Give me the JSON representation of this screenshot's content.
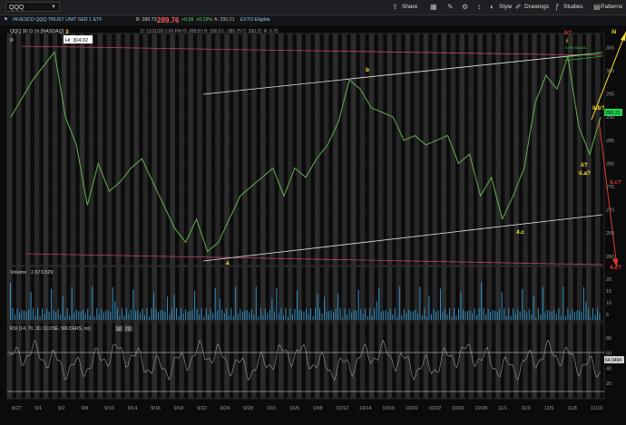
{
  "toolbar": {
    "symbol": "QQQ",
    "share_label": "Share",
    "style_label": "Style",
    "drawings_label": "Drawings",
    "studies_label": "Studies",
    "patterns_label": "Patterns"
  },
  "info": {
    "symbol_desc": "QQQ 90 D 1h [NASDAQ]",
    "fund_name": "INVESCO QQQ TRUST UNIT SER 1 ETF",
    "last_price": "289.76",
    "change_top": "+0.56",
    "change_bottom": "+0.19%",
    "bid_ask_top": "B: 289.73",
    "bid_ask_bottom": "A: 290.21",
    "ext_label": "EXTO Eligible",
    "ohlc": "D: 11/11/20 1:00 PM   O: 289.81   H: 290.5   L: 289.75   C: 290.21   R: 0.75"
  },
  "price_panel": {
    "y_ticks": [
      "305",
      "300",
      "295",
      "290",
      "285",
      "280",
      "275",
      "270",
      "265",
      "260"
    ],
    "hi_label": "Hi: 304.02",
    "current_price": "290.21",
    "wave_labels": {
      "w3": "3",
      "b": "b",
      "a": "a",
      "c4": "4.c",
      "bq": "b?",
      "i": "i",
      "iii": "iii",
      "iib": "ii.b?",
      "ii": "ii?",
      "iia": "ii.a?",
      "iic": "ii.c?",
      "c4q": "4.c?"
    },
    "fib_labels": [
      "0.0%  304.44",
      "100%"
    ]
  },
  "volume_panel": {
    "title": "Volume",
    "value": "2,673,529",
    "y_ticks": [
      "20",
      "15",
      "10",
      "5"
    ]
  },
  "rsi_panel": {
    "title": "RSI (14, 70, 30, CLOSE, WILDERS, no)",
    "value": "64.9494",
    "levels": [
      "30",
      "70"
    ],
    "y_ticks": [
      "80",
      "60",
      "40",
      "20"
    ]
  },
  "x_axis": {
    "labels": [
      "8/27",
      "9/1",
      "9/2",
      "9/8",
      "9/10",
      "9/14",
      "9/16",
      "9/18",
      "9/22",
      "9/24",
      "9/28",
      "10/1",
      "10/6",
      "10/8",
      "10/12",
      "10/14",
      "10/16",
      "10/20",
      "10/22",
      "10/26",
      "10/28",
      "11/1",
      "11/3",
      "11/5",
      "11/8",
      "11/10"
    ]
  },
  "chart_data": {
    "type": "line",
    "title": "QQQ 90 D 1h [NASDAQ]",
    "xlabel": "",
    "ylabel": "",
    "ylim": [
      258,
      308
    ],
    "series": [
      {
        "name": "QQQ",
        "points": [
          {
            "x": "8/27",
            "y": 290
          },
          {
            "x": "8/28",
            "y": 294
          },
          {
            "x": "8/31",
            "y": 298
          },
          {
            "x": "9/1",
            "y": 301
          },
          {
            "x": "9/2",
            "y": 304
          },
          {
            "x": "9/3",
            "y": 290
          },
          {
            "x": "9/4",
            "y": 284
          },
          {
            "x": "9/8",
            "y": 271
          },
          {
            "x": "9/9",
            "y": 280
          },
          {
            "x": "9/10",
            "y": 274
          },
          {
            "x": "9/11",
            "y": 276
          },
          {
            "x": "9/14",
            "y": 279
          },
          {
            "x": "9/15",
            "y": 281
          },
          {
            "x": "9/16",
            "y": 276
          },
          {
            "x": "9/17",
            "y": 271
          },
          {
            "x": "9/18",
            "y": 266
          },
          {
            "x": "9/21",
            "y": 263
          },
          {
            "x": "9/22",
            "y": 268
          },
          {
            "x": "9/23",
            "y": 261
          },
          {
            "x": "9/24",
            "y": 263
          },
          {
            "x": "9/25",
            "y": 268
          },
          {
            "x": "9/28",
            "y": 273
          },
          {
            "x": "9/29",
            "y": 275
          },
          {
            "x": "9/30",
            "y": 277
          },
          {
            "x": "10/1",
            "y": 279
          },
          {
            "x": "10/2",
            "y": 273
          },
          {
            "x": "10/5",
            "y": 279
          },
          {
            "x": "10/6",
            "y": 277
          },
          {
            "x": "10/7",
            "y": 281
          },
          {
            "x": "10/8",
            "y": 284
          },
          {
            "x": "10/9",
            "y": 289
          },
          {
            "x": "10/12",
            "y": 298
          },
          {
            "x": "10/13",
            "y": 296
          },
          {
            "x": "10/14",
            "y": 292
          },
          {
            "x": "10/15",
            "y": 291
          },
          {
            "x": "10/16",
            "y": 290
          },
          {
            "x": "10/19",
            "y": 285
          },
          {
            "x": "10/20",
            "y": 286
          },
          {
            "x": "10/21",
            "y": 284
          },
          {
            "x": "10/22",
            "y": 285
          },
          {
            "x": "10/23",
            "y": 286
          },
          {
            "x": "10/26",
            "y": 280
          },
          {
            "x": "10/27",
            "y": 282
          },
          {
            "x": "10/28",
            "y": 273
          },
          {
            "x": "10/29",
            "y": 277
          },
          {
            "x": "10/30",
            "y": 268
          },
          {
            "x": "11/2",
            "y": 273
          },
          {
            "x": "11/3",
            "y": 279
          },
          {
            "x": "11/4",
            "y": 293
          },
          {
            "x": "11/5",
            "y": 299
          },
          {
            "x": "11/6",
            "y": 296
          },
          {
            "x": "11/9",
            "y": 303
          },
          {
            "x": "11/9b",
            "y": 288
          },
          {
            "x": "11/10",
            "y": 282
          },
          {
            "x": "11/11",
            "y": 290
          }
        ]
      }
    ]
  }
}
